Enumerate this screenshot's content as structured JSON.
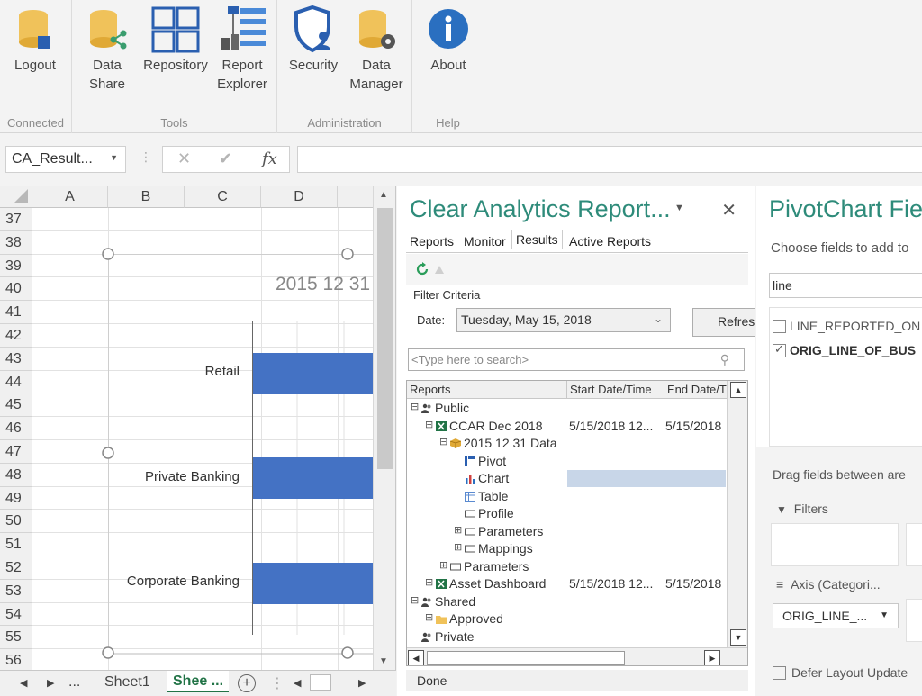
{
  "ribbon": {
    "groups": [
      {
        "label": "Connected",
        "buttons": [
          {
            "label": "Logout",
            "icon": "logout-icon"
          }
        ]
      },
      {
        "label": "Tools",
        "buttons": [
          {
            "label": "Data Share",
            "line1": "Data",
            "line2": "Share",
            "icon": "data-share-icon"
          },
          {
            "label": "Repository",
            "icon": "repository-icon"
          },
          {
            "label": "Report Explorer",
            "line1": "Report",
            "line2": "Explorer",
            "icon": "report-explorer-icon"
          }
        ]
      },
      {
        "label": "Administration",
        "buttons": [
          {
            "label": "Security",
            "icon": "security-icon"
          },
          {
            "label": "Data Manager",
            "line1": "Data",
            "line2": "Manager",
            "icon": "data-manager-icon"
          }
        ]
      },
      {
        "label": "Help",
        "buttons": [
          {
            "label": "About",
            "icon": "about-icon"
          }
        ]
      }
    ]
  },
  "formula_bar": {
    "name_box": "CA_Result...",
    "cancel": "✕",
    "enter": "✔",
    "fx": "fx",
    "value": ""
  },
  "sheet": {
    "columns": [
      "A",
      "B",
      "C",
      "D"
    ],
    "rows": [
      "37",
      "38",
      "39",
      "40",
      "41",
      "42",
      "43",
      "44",
      "45",
      "46",
      "47",
      "48",
      "49",
      "50",
      "51",
      "52",
      "53",
      "54",
      "55",
      "56"
    ],
    "chart": {
      "title": "2015 12 31",
      "categories": [
        "Retail",
        "Private Banking",
        "Corporate Banking"
      ]
    },
    "tabs": {
      "ellipsis_left": "...",
      "sheet1": "Sheet1",
      "active": "Shee ...",
      "add": "+"
    }
  },
  "clear_analytics": {
    "title": "Clear Analytics Report...",
    "tabs": [
      "Reports",
      "Monitor",
      "Results",
      "Active Reports"
    ],
    "active_tab": "Results",
    "filter_label": "Filter Criteria",
    "date_label": "Date:",
    "date_value": "Tuesday, May 15, 2018",
    "refresh_label": "Refresh",
    "search_placeholder": "<Type here to search>",
    "columns": [
      "Reports",
      "Start Date/Time",
      "End Date/Time"
    ],
    "tree": [
      {
        "label": "Public",
        "indent": 0,
        "toggle": "⊟",
        "icon": "users",
        "start": "",
        "end": ""
      },
      {
        "label": "CCAR Dec 2018",
        "indent": 1,
        "toggle": "⊟",
        "icon": "excel",
        "start": "5/15/2018 12...",
        "end": "5/15/2018"
      },
      {
        "label": "2015 12 31 Data",
        "indent": 2,
        "toggle": "⊟",
        "icon": "cube",
        "start": "",
        "end": ""
      },
      {
        "label": "Pivot",
        "indent": 3,
        "toggle": "",
        "icon": "pivot",
        "start": "",
        "end": ""
      },
      {
        "label": "Chart",
        "indent": 3,
        "toggle": "",
        "icon": "chart",
        "start": "",
        "end": "",
        "selected": true
      },
      {
        "label": "Table",
        "indent": 3,
        "toggle": "",
        "icon": "table",
        "start": "",
        "end": ""
      },
      {
        "label": "Profile",
        "indent": 3,
        "toggle": "",
        "icon": "box",
        "start": "",
        "end": ""
      },
      {
        "label": "Parameters",
        "indent": 3,
        "toggle": "⊞",
        "icon": "box",
        "start": "",
        "end": ""
      },
      {
        "label": "Mappings",
        "indent": 3,
        "toggle": "⊞",
        "icon": "box",
        "start": "",
        "end": ""
      },
      {
        "label": "Parameters",
        "indent": 2,
        "toggle": "⊞",
        "icon": "box",
        "start": "",
        "end": ""
      },
      {
        "label": "Asset Dashboard",
        "indent": 1,
        "toggle": "⊞",
        "icon": "excel",
        "start": "5/15/2018 12...",
        "end": "5/15/2018"
      },
      {
        "label": "Shared",
        "indent": 0,
        "toggle": "⊟",
        "icon": "users",
        "start": "",
        "end": ""
      },
      {
        "label": "Approved",
        "indent": 1,
        "toggle": "⊞",
        "icon": "folder",
        "start": "",
        "end": ""
      },
      {
        "label": "Private",
        "indent": 0,
        "toggle": "",
        "icon": "users",
        "start": "",
        "end": ""
      }
    ],
    "status": "Done"
  },
  "pivot_pane": {
    "title": "PivotChart Fie",
    "choose_text": "Choose fields to add to",
    "search_value": "line",
    "fields": [
      {
        "label": "LINE_REPORTED_ON",
        "checked": false
      },
      {
        "label": "ORIG_LINE_OF_BUS",
        "checked": true
      }
    ],
    "drag_text": "Drag fields between are",
    "filters_label": "Filters",
    "axis_label": "Axis (Categori...",
    "axis_chip": "ORIG_LINE_...",
    "defer_label": "Defer Layout Update"
  },
  "colors": {
    "accent_teal": "#2e8b7a",
    "bar_blue": "#4472c4",
    "selection": "#c8d6e8"
  }
}
